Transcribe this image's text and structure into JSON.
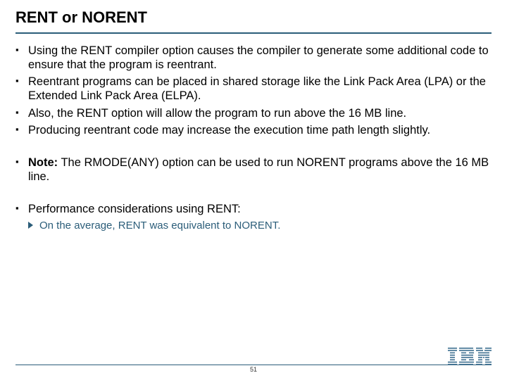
{
  "title": "RENT or NORENT",
  "bullets": {
    "b1": "Using the RENT compiler option causes the compiler to generate some additional code to ensure that the program is reentrant.",
    "b2": "Reentrant programs can be placed in shared storage like the Link Pack Area (LPA) or the Extended Link Pack Area (ELPA).",
    "b3": "Also, the RENT option will allow the program to run above the 16 MB line.",
    "b4": "Producing reentrant code may increase the execution time path length slightly.",
    "note_label": "Note:",
    "note_text": " The RMODE(ANY) option can be used to run NORENT programs above the 16 MB line.",
    "perf": "Performance considerations using RENT:",
    "sub1": "On the average, RENT was equivalent to NORENT."
  },
  "page_number": "51",
  "logo_alt": "IBM"
}
